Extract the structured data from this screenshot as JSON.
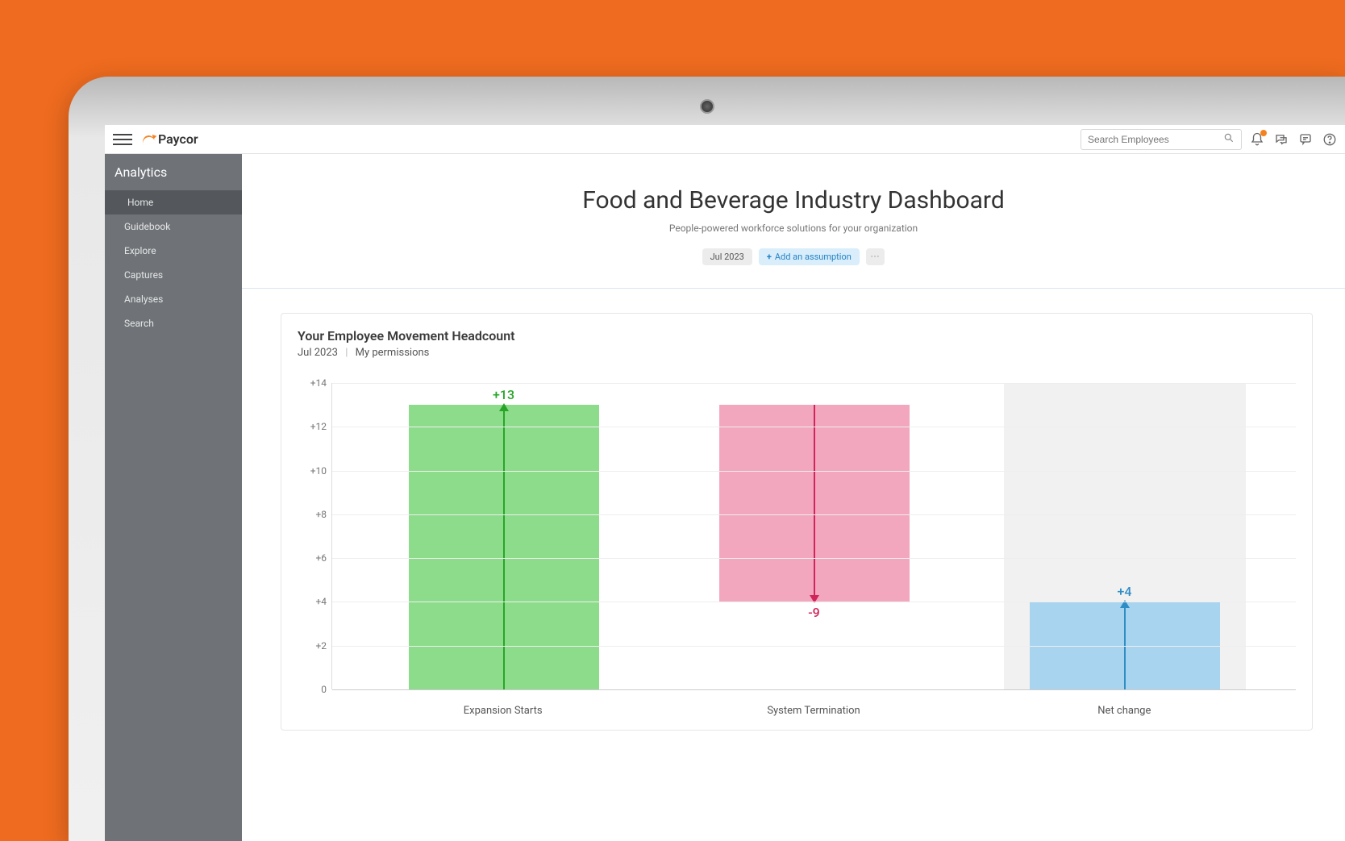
{
  "brand": "Paycor",
  "search": {
    "placeholder": "Search Employees"
  },
  "sidebar": {
    "title": "Analytics",
    "items": [
      {
        "label": "Home",
        "active": true
      },
      {
        "label": "Guidebook",
        "active": false
      },
      {
        "label": "Explore",
        "active": false
      },
      {
        "label": "Captures",
        "active": false
      },
      {
        "label": "Analyses",
        "active": false
      },
      {
        "label": "Search",
        "active": false
      }
    ]
  },
  "dashboard": {
    "title": "Food and Beverage Industry Dashboard",
    "subtitle": "People-powered workforce solutions for your organization",
    "date_chip": "Jul 2023",
    "add_assumption_label": "Add an assumption",
    "more_label": "···"
  },
  "card": {
    "title": "Your Employee Movement Headcount",
    "period": "Jul 2023",
    "scope": "My permissions"
  },
  "chart_data": {
    "type": "bar",
    "title": "Your Employee Movement Headcount",
    "ylim": [
      0,
      14
    ],
    "yticks": [
      0,
      2,
      4,
      6,
      8,
      10,
      12,
      14
    ],
    "ytick_labels": [
      "0",
      "+2",
      "+4",
      "+6",
      "+8",
      "+10",
      "+12",
      "+14"
    ],
    "categories": [
      "Expansion Starts",
      "System Termination",
      "Net change"
    ],
    "series": [
      {
        "name": "Expansion Starts",
        "bar_top": 13,
        "bar_bottom": 0,
        "value": 13,
        "value_label": "+13",
        "direction": "up",
        "color": "#8ddc8b",
        "arrow_color": "#28a528",
        "label_color": "#28a528"
      },
      {
        "name": "System Termination",
        "bar_top": 13,
        "bar_bottom": 4,
        "value": -9,
        "value_label": "-9",
        "direction": "down",
        "color": "#f2a7be",
        "arrow_color": "#d0255b",
        "label_color": "#d0255b"
      },
      {
        "name": "Net change",
        "bar_top": 4,
        "bar_bottom": 0,
        "value": 4,
        "value_label": "+4",
        "direction": "up",
        "color": "#a8d4ef",
        "arrow_color": "#2f8dc6",
        "label_color": "#2f8dc6",
        "net_bg": true
      }
    ]
  }
}
